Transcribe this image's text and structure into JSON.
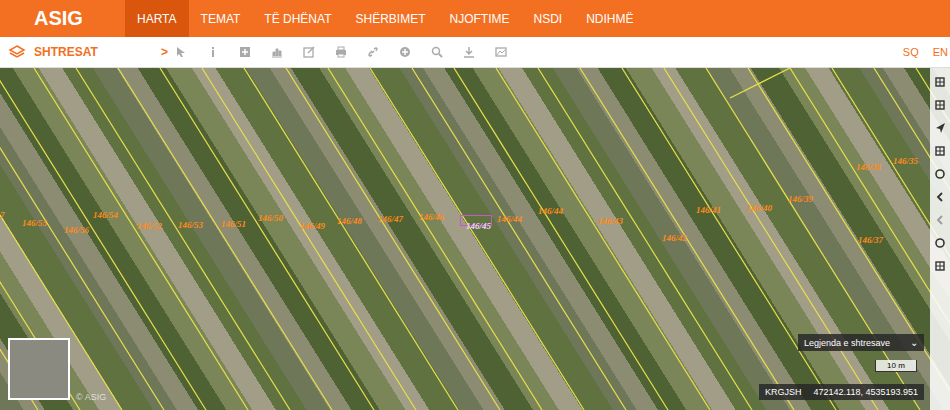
{
  "header": {
    "logo": "ASIG",
    "menu": [
      {
        "label": "HARTA",
        "selected": true
      },
      {
        "label": "TEMAT",
        "selected": false
      },
      {
        "label": "TË DHËNAT",
        "selected": false
      },
      {
        "label": "SHËRBIMET",
        "selected": false
      },
      {
        "label": "NJOFTIME",
        "selected": false
      },
      {
        "label": "NSDI",
        "selected": false
      },
      {
        "label": "NDIHMË",
        "selected": false
      }
    ]
  },
  "toolbar": {
    "layers_label": "SHTRESAT",
    "expand": ">",
    "languages": [
      "SQ",
      "EN"
    ]
  },
  "map": {
    "parcels": [
      "7",
      "146/55",
      "146/56",
      "146/54",
      "146/52",
      "146/53",
      "146/51",
      "146/50",
      "146/49",
      "146/48",
      "146/47",
      "146/46",
      "146/44",
      "146/44",
      "146/43",
      "146/42",
      "146/41",
      "146/40",
      "146/39",
      "146/38",
      "146/35",
      "146/37"
    ],
    "highlight_label": "146/45",
    "watermark": "© ASIG",
    "legend": {
      "label": "Legjenda e shtresave",
      "expand": "⌄"
    },
    "scale": "10 m",
    "coordinates": {
      "system": "KRGJSH",
      "value": "472142.118, 4535193.951"
    }
  }
}
